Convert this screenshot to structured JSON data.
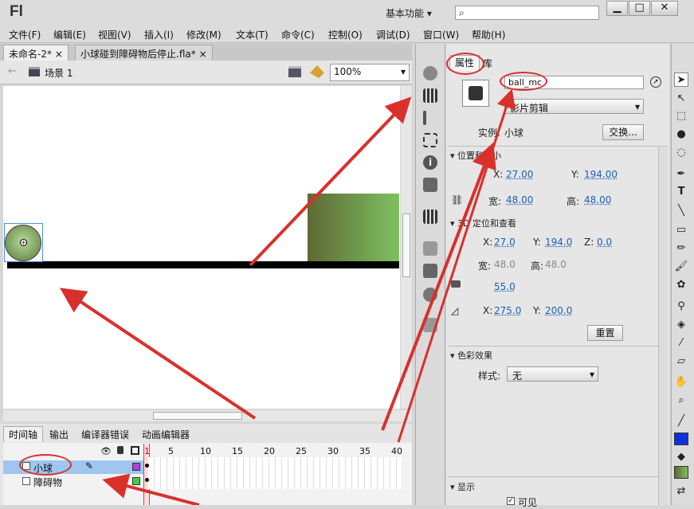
{
  "app": {
    "logo": "Fl",
    "workspace": "基本功能",
    "workspace_arrow": "▾",
    "search_placeholder": ""
  },
  "window": {
    "min": "▁",
    "max": "□",
    "close": "✕"
  },
  "menu": [
    "文件(F)",
    "编辑(E)",
    "视图(V)",
    "插入(I)",
    "修改(M)",
    "文本(T)",
    "命令(C)",
    "控制(O)",
    "调试(D)",
    "窗口(W)",
    "帮助(H)"
  ],
  "doc_tabs": [
    {
      "label": "未命名-2*",
      "close": "×"
    },
    {
      "label": "小球碰到障碍物后停止.fla*",
      "close": "×"
    }
  ],
  "editbar": {
    "back": "←",
    "scene": "场景 1",
    "zoom": "100%",
    "zoom_arrow": "▾"
  },
  "timeline": {
    "tabs": [
      "时间轴",
      "输出",
      "编译器错误",
      "动画编辑器"
    ],
    "frame_numbers": [
      "1",
      "5",
      "10",
      "15",
      "20",
      "25",
      "30",
      "35",
      "40"
    ],
    "layers": [
      {
        "name": "小球",
        "color": "#b040d0"
      },
      {
        "name": "障碍物",
        "color": "#40d040"
      }
    ]
  },
  "props": {
    "tabs": [
      "属性",
      "库"
    ],
    "instance_name": "ball_mc",
    "symbol_type": "影片剪辑",
    "instance_label": "实例:",
    "instance_of": "小球",
    "swap_button": "交换...",
    "sections": {
      "pos": "位置和大小",
      "3d": "3D 定位和查看",
      "color": "色彩效果",
      "display": "显示"
    },
    "pos": {
      "x_label": "X:",
      "x": "27.00",
      "y_label": "Y:",
      "y": "194.00",
      "w_label": "宽:",
      "w": "48.00",
      "h_label": "高:",
      "h": "48.00"
    },
    "p3d": {
      "x_label": "X:",
      "x": "27.0",
      "y_label": "Y:",
      "y": "194.0",
      "z_label": "Z:",
      "z": "0.0",
      "w_label": "宽:",
      "w": "48.0",
      "h_label": "高:",
      "h": "48.0",
      "persp": "55.0",
      "vx_label": "X:",
      "vx": "275.0",
      "vy_label": "Y:",
      "vy": "200.0"
    },
    "reset_button": "重置",
    "style_label": "样式:",
    "style_value": "无",
    "visible_label": "可见"
  },
  "colors": {
    "accent_red": "#d9302c",
    "layer_selected": "#9ec6ef",
    "fill_swatch": "#1030e0"
  }
}
